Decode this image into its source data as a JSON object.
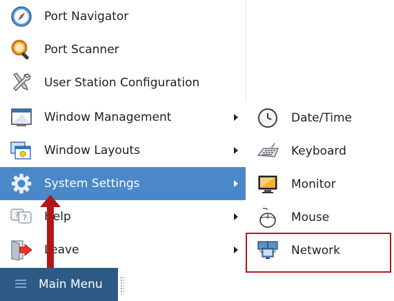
{
  "menu": {
    "items": [
      {
        "label": "Port Navigator",
        "icon": "compass-icon",
        "has_submenu": false
      },
      {
        "label": "Port Scanner",
        "icon": "magnifier-icon",
        "has_submenu": false
      },
      {
        "label": "User Station Configuration",
        "icon": "tools-icon",
        "has_submenu": false
      },
      {
        "label": "Window Management",
        "icon": "window-management-icon",
        "has_submenu": true
      },
      {
        "label": "Window Layouts",
        "icon": "window-layouts-icon",
        "has_submenu": true
      },
      {
        "label": "System Settings",
        "icon": "gear-icon",
        "has_submenu": true,
        "selected": true
      },
      {
        "label": "Help",
        "icon": "help-icon",
        "has_submenu": true
      },
      {
        "label": "Leave",
        "icon": "leave-icon",
        "has_submenu": true
      }
    ]
  },
  "submenu": {
    "items": [
      {
        "label": "Date/Time",
        "icon": "clock-icon"
      },
      {
        "label": "Keyboard",
        "icon": "keyboard-icon"
      },
      {
        "label": "Monitor",
        "icon": "monitor-icon"
      },
      {
        "label": "Mouse",
        "icon": "mouse-icon"
      },
      {
        "label": "Network",
        "icon": "network-icon"
      }
    ]
  },
  "taskbar": {
    "label": "Main Menu",
    "icon": "hamburger-menu-icon"
  },
  "colors": {
    "selected_bg": "#4a88c9",
    "taskbar_bg": "#2d5a84",
    "annotation": "#b01818"
  }
}
